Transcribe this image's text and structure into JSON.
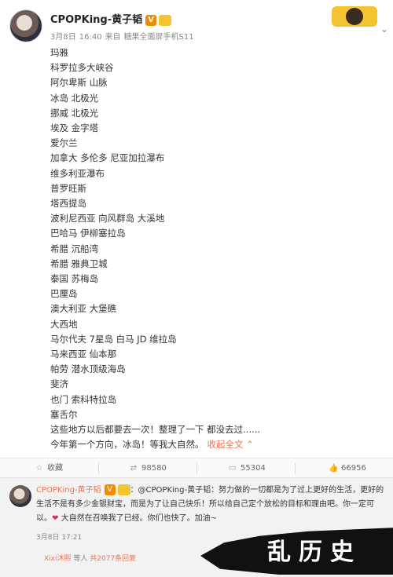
{
  "post": {
    "username": "CPOPKing-黄子韬",
    "verified_badge": "V",
    "date": "3月8日",
    "time": "16:40",
    "source_prefix": "来自",
    "source": "糖果全面屏手机S11",
    "places": [
      "玛雅",
      "科罗拉多大峡谷",
      "阿尔卑斯 山脉",
      "冰岛 北极光",
      "挪威 北极光",
      "埃及 金字塔",
      "爱尔兰",
      "加拿大 多伦多 尼亚加拉瀑布",
      "维多利亚瀑布",
      "普罗旺斯",
      "塔西提岛",
      "波利尼西亚 向风群岛 大溪地",
      "巴哈马 伊柳塞拉岛",
      "希腊 沉船湾",
      "希腊 雅典卫城",
      "泰国 苏梅岛",
      "巴厘岛",
      "澳大利亚 大堡礁",
      "大西地",
      "马尔代夫 7星岛 白马 JD 维拉岛",
      "马来西亚 仙本那",
      "帕劳 潜水顶级海岛",
      "斐济",
      "也门 索科特拉岛",
      "塞舌尔",
      "这些地方以后都要去一次！整理了一下 都没去过......"
    ],
    "last_line": "今年第一个方向，冰岛！等我大自然。",
    "expand_label": "收起全文",
    "expand_icon": "chevron-up"
  },
  "actions": {
    "collect": "收藏",
    "repost_count": "98580",
    "comment_count": "55304",
    "like_count": "66956"
  },
  "comment": {
    "author": "CPOPKing-黄子韬",
    "verified_badge": "V",
    "text_part1": "：@CPOPKing-黄子韬：努力做的一切都是为了过上更好的生活，更好的生活不是有多少金银财宝，而是为了让自己快乐！所以给自己定个放松的目标和理由吧。你一定可以。",
    "heart": "❤",
    "text_part2": " 大自然在召唤我了已经。你们也快了。加油~",
    "time": "3月8日 17:21",
    "reply_user": "Xixi沐熙",
    "reply_middle": "等人",
    "reply_count_text": "共2077条回复"
  },
  "watermark": "乱历史",
  "colors": {
    "accent_orange": "#eb7350",
    "badge_orange": "#f08a00",
    "watermark_bg": "#111111"
  }
}
